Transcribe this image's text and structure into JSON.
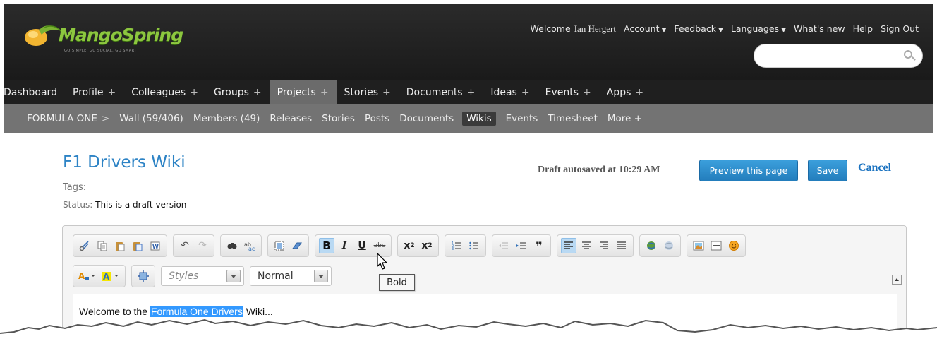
{
  "brand": {
    "name": "MangoSpring",
    "tagline": "GO SIMPLE. GO SOCIAL. GO SMART"
  },
  "topnav": {
    "welcome": "Welcome",
    "user": "Ian Hergert",
    "account": "Account",
    "feedback": "Feedback",
    "languages": "Languages",
    "whats_new": "What's new",
    "help": "Help",
    "sign_out": "Sign Out"
  },
  "mainnav": [
    {
      "label": "Dashboard",
      "plus": ""
    },
    {
      "label": "Profile",
      "plus": "+"
    },
    {
      "label": "Colleagues",
      "plus": "+"
    },
    {
      "label": "Groups",
      "plus": "+"
    },
    {
      "label": "Projects",
      "plus": "+"
    },
    {
      "label": "Stories",
      "plus": "+"
    },
    {
      "label": "Documents",
      "plus": "+"
    },
    {
      "label": "Ideas",
      "plus": "+"
    },
    {
      "label": "Events",
      "plus": "+"
    },
    {
      "label": "Apps",
      "plus": "+"
    }
  ],
  "subnav": {
    "project": "FORMULA ONE",
    "sep": ">",
    "items": [
      "Wall (59/406)",
      "Members (49)",
      "Releases",
      "Stories",
      "Posts",
      "Documents",
      "Wikis",
      "Events",
      "Timesheet",
      "More +"
    ]
  },
  "page": {
    "title": "F1 Drivers Wiki",
    "tags_label": "Tags:",
    "status_label": "Status:",
    "status_value": "This is a draft version",
    "autosave": "Draft autosaved at 10:29 AM",
    "preview_btn": "Preview this page",
    "save_btn": "Save",
    "cancel": "Cancel"
  },
  "editor": {
    "styles_placeholder": "Styles",
    "format_value": "Normal",
    "tooltip": "Bold",
    "text_before": "Welcome to the ",
    "text_highlight": "Formula One Drivers",
    "text_after": " Wiki..."
  }
}
